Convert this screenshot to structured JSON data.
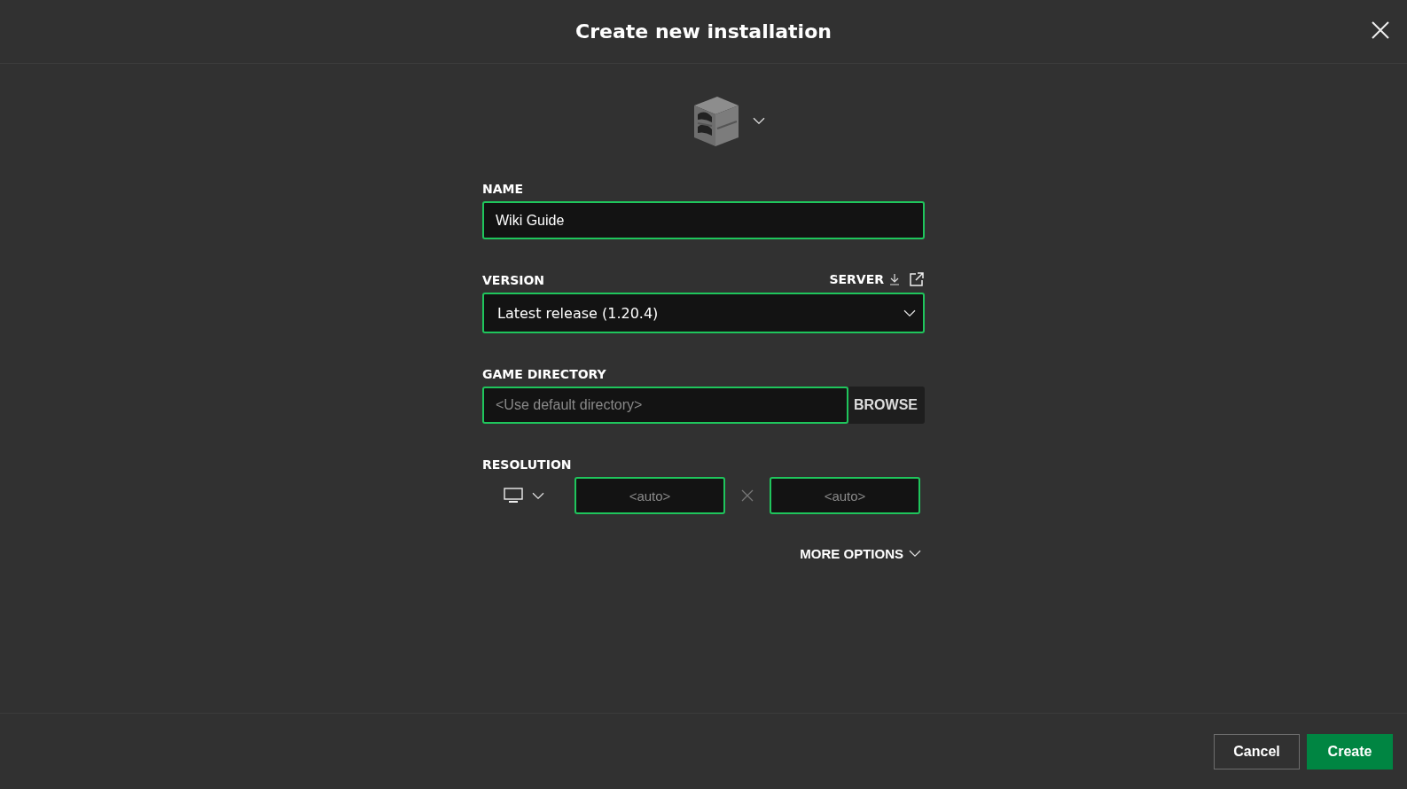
{
  "dialog": {
    "title": "Create new installation"
  },
  "name": {
    "label": "NAME",
    "value": "Wiki Guide"
  },
  "version": {
    "label": "VERSION",
    "value": "Latest release (1.20.4)",
    "server_link": "SERVER"
  },
  "game_directory": {
    "label": "GAME DIRECTORY",
    "placeholder": "<Use default directory>",
    "browse_button": "BROWSE"
  },
  "resolution": {
    "label": "RESOLUTION",
    "width_placeholder": "<auto>",
    "height_placeholder": "<auto>"
  },
  "more_options": "MORE OPTIONS",
  "buttons": [
    {
      "label": "Cancel",
      "kind": "secondary"
    },
    {
      "label": "Create",
      "kind": "primary"
    }
  ]
}
